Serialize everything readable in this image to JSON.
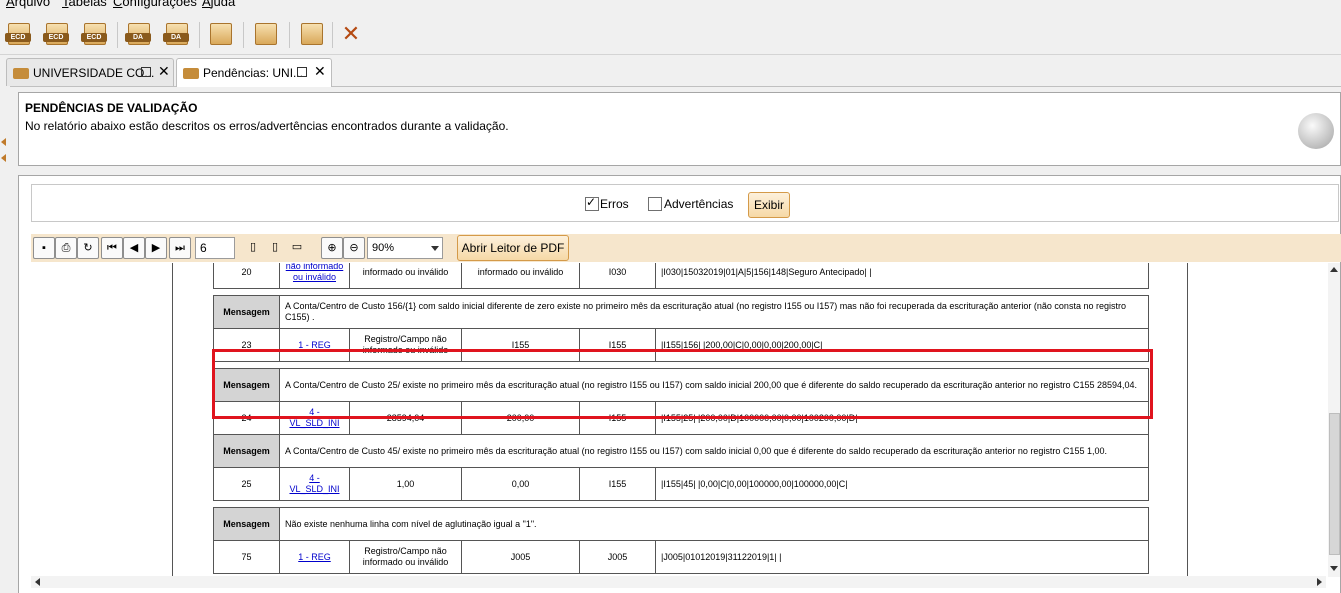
{
  "menu": [
    "Arquivo",
    "Tabelas",
    "Configurações",
    "Ajuda"
  ],
  "toolbar": {
    "buttons": [
      {
        "icon": "ecd-import-icon",
        "label": "ECD"
      },
      {
        "icon": "ecd-validate-icon",
        "label": "ECD"
      },
      {
        "icon": "ecd-sign-icon",
        "label": "ECD"
      },
      {
        "icon": "da-import-icon",
        "label": "DA"
      },
      {
        "icon": "da-remove-icon",
        "label": "DA"
      },
      {
        "icon": "transmit-icon",
        "label": ""
      },
      {
        "icon": "edit-icon",
        "label": ""
      },
      {
        "icon": "help-icon",
        "label": ""
      }
    ],
    "close_glyph": "✕"
  },
  "tabs": [
    {
      "label": "UNIVERSIDADE CO..."
    },
    {
      "label": "Pendências: UNI..."
    }
  ],
  "header": {
    "title": "PENDÊNCIAS DE VALIDAÇÃO",
    "description": "No relatório abaixo estão descritos os erros/advertências encontrados durante a validação."
  },
  "filters": {
    "erros_label": "Erros",
    "erros_checked": true,
    "advertencias_label": "Advertências",
    "advertencias_checked": false,
    "exibir_label": "Exibir"
  },
  "pdf_toolbar": {
    "page": "6",
    "zoom": "90%",
    "reader_label": "Abrir Leitor de PDF"
  },
  "report": {
    "msg_label": "Mensagem",
    "top_partial": {
      "line": "20",
      "field": "não informado ou inválido",
      "c3": "informado ou inválido",
      "c4": "informado ou inválido",
      "reg": "I030",
      "content": "|I030|15032019|01|A|5|156|148|Seguro Antecipado| |"
    },
    "entries": [
      {
        "message": "A Conta/Centro de Custo 156/{1} com saldo inicial diferente de zero existe  no primeiro mês da escrituração atual (no registro I155 ou I157) mas não foi recuperada da escrituração anterior (não consta no registro C155) .",
        "line": "23",
        "field": "1 - REG",
        "c3": "Registro/Campo não informado ou inválido",
        "c4": "I155",
        "reg": "I155",
        "content": "|I155|156| |200,00|C|0,00|0,00|200,00|C|"
      },
      {
        "message": "A Conta/Centro de Custo 25/ existe no primeiro mês da escrituração atual (no registro I155 ou I157) com saldo inicial 200,00 que é diferente do saldo  recuperado da escrituração anterior no registro C155 28594,04.",
        "line": "24",
        "field": "4 - VL_SLD_INI",
        "c3": "28594,04",
        "c4": "200,00",
        "reg": "I155",
        "content": "|I155|25| |200,00|D|100000,00|0,00|100200,00|D|"
      },
      {
        "message": "A Conta/Centro de Custo 45/ existe no primeiro mês da escrituração atual (no registro I155 ou I157) com saldo inicial 0,00 que é diferente do saldo  recuperado da escrituração anterior no registro C155 1,00.",
        "line": "25",
        "field": "4 - VL_SLD_INI",
        "c3": "1,00",
        "c4": "0,00",
        "reg": "I155",
        "content": "|I155|45| |0,00|C|0,00|100000,00|100000,00|C|"
      },
      {
        "message": "Não existe nenhuma linha com nível de aglutinação igual a \"1\".",
        "line": "75",
        "field": "1 - REG",
        "c3": "Registro/Campo não informado ou inválido",
        "c4": "J005",
        "reg": "J005",
        "content": "|J005|01012019|31122019|1| |"
      }
    ]
  },
  "colors": {
    "highlight": "#e0141e",
    "accent": "#f6d9a6",
    "link": "#0000cc"
  }
}
